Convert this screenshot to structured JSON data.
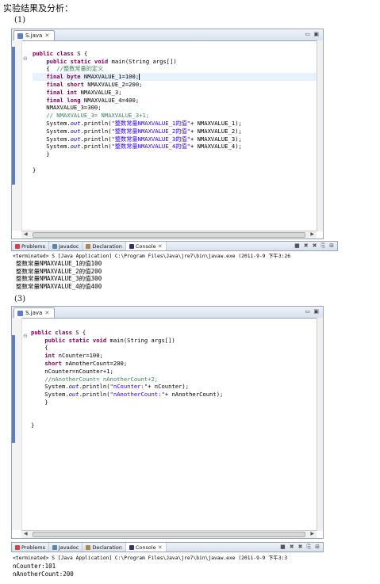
{
  "heading": "实验结果及分析：",
  "section1_label": "(1)",
  "section3_label": "(3)",
  "editor1": {
    "tab_label": "S.java",
    "lines": [
      {
        "text": "",
        "hl": false
      },
      {
        "text": "public class S {",
        "hl": false
      },
      {
        "text": "    public static void main(String args[])",
        "hl": false
      },
      {
        "text": "    {  //整数常量的定义",
        "hl": false
      },
      {
        "text": "    final byte NMAXVALUE_1=100;",
        "hl": true
      },
      {
        "text": "    final short NMAXVALUE_2=200;",
        "hl": false
      },
      {
        "text": "    final int NMAXVALUE_3;",
        "hl": false
      },
      {
        "text": "    final long NMAXVALUE_4=400;",
        "hl": false
      },
      {
        "text": "    NMAXVALUE_3=300;",
        "hl": false
      },
      {
        "text": "    // NMAXVALUE_3= NMAXVALUE_3+1;",
        "hl": false
      },
      {
        "text": "    System.out.println(\"整数常量NMAXVALUE_1的值\"+ NMAXVALUE_1);",
        "hl": false
      },
      {
        "text": "    System.out.println(\"整数常量NMAXVALUE_2的值\"+ NMAXVALUE_2);",
        "hl": false
      },
      {
        "text": "    System.out.println(\"整数常量NMAXVALUE_3的值\"+ NMAXVALUE_3);",
        "hl": false
      },
      {
        "text": "    System.out.println(\"整数常量NMAXVALUE_4的值\"+ NMAXVALUE_4);",
        "hl": false
      },
      {
        "text": "    }",
        "hl": false
      },
      {
        "text": "",
        "hl": false
      },
      {
        "text": "}",
        "hl": false
      }
    ]
  },
  "console1": {
    "tabs": [
      "Problems",
      "Javadoc",
      "Declaration",
      "Console"
    ],
    "terminated": "<terminated> S [Java Application] C:\\Program Files\\Java\\jre7\\bin\\javaw.exe (2011-9-9 下午3:26",
    "output": [
      "整数常量NMAXVALUE_1的值100",
      "整数常量NMAXVALUE_2的值200",
      "整数常量NMAXVALUE_3的值300",
      "整数常量NMAXVALUE_4的值400"
    ]
  },
  "editor2": {
    "tab_label": "S.java",
    "lines": [
      {
        "text": "",
        "hl": false
      },
      {
        "text": "public class S {",
        "hl": false
      },
      {
        "text": "    public static void main(String args[])",
        "hl": false
      },
      {
        "text": "    {",
        "hl": false
      },
      {
        "text": "    int nCounter=100;",
        "hl": false
      },
      {
        "text": "    short nAnotherCount=200;",
        "hl": false
      },
      {
        "text": "    nCounter=nCounter+1;",
        "hl": false
      },
      {
        "text": "    //nAnotherCount= nAnotherCount+2;",
        "hl": false
      },
      {
        "text": "    System.out.println(\"nCounter:\"+ nCounter);",
        "hl": false
      },
      {
        "text": "    System.out.println(\"nAnotherCount:\"+ nAnotherCount);",
        "hl": false
      },
      {
        "text": "    }",
        "hl": false
      },
      {
        "text": "",
        "hl": false
      },
      {
        "text": "",
        "hl": false
      },
      {
        "text": "}",
        "hl": false
      }
    ]
  },
  "console2": {
    "tabs": [
      "Problems",
      "Javadoc",
      "Declaration",
      "Console"
    ],
    "terminated": "<terminated> S [Java Application] C:\\Program Files\\Java\\jre7\\bin\\javaw.exe (2011-9-9 下午3:3",
    "output": [
      "nCounter:101",
      "nAnotherCount:200"
    ]
  },
  "colors": {
    "keyword": "#7f0055",
    "comment": "#3f7f5f",
    "string": "#2a00ff",
    "field": "#0000c0"
  }
}
